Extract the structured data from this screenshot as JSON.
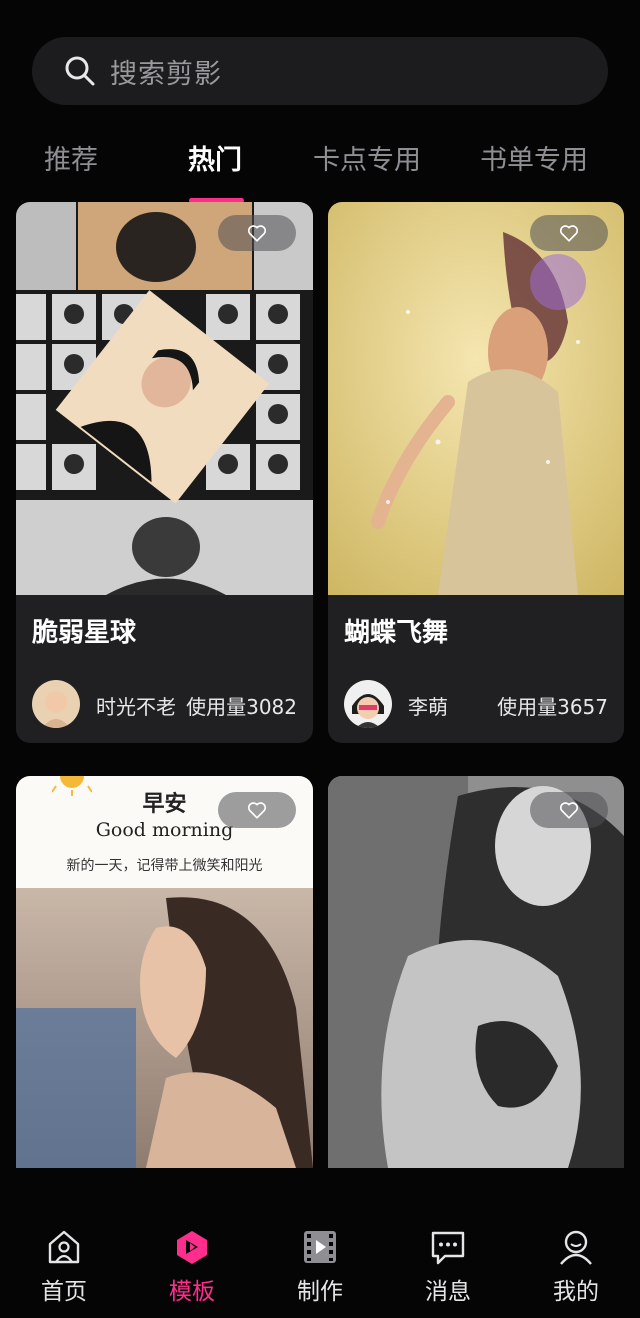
{
  "search": {
    "placeholder": "搜索剪影"
  },
  "tabs": [
    {
      "label": "推荐",
      "active": false
    },
    {
      "label": "热门",
      "active": true
    },
    {
      "label": "卡点专用",
      "active": false
    },
    {
      "label": "书单专用",
      "active": false
    }
  ],
  "cards": [
    {
      "title": "脆弱星球",
      "author": "时光不老",
      "usage": "使用量3082",
      "thumbnail": "collage-bw-portraits-photo"
    },
    {
      "title": "蝴蝶飞舞",
      "author": "李萌",
      "usage": "使用量3657",
      "thumbnail": "dancing-girl-yellow-photo"
    },
    {
      "thumbnail_heading": "早安",
      "thumbnail_subheading": "Good morning",
      "thumbnail_caption": "新的一天，记得带上微笑和阳光",
      "thumbnail": "woman-profile-photo"
    },
    {
      "thumbnail": "bw-woman-portrait-photo"
    }
  ],
  "nav": [
    {
      "label": "首页",
      "icon": "home-person-icon",
      "active": false
    },
    {
      "label": "模板",
      "icon": "template-icon",
      "active": true
    },
    {
      "label": "制作",
      "icon": "film-play-icon",
      "active": false
    },
    {
      "label": "消息",
      "icon": "message-icon",
      "active": false
    },
    {
      "label": "我的",
      "icon": "profile-icon",
      "active": false
    }
  ],
  "colors": {
    "accent": "#ff2e8c",
    "background": "#050506",
    "card": "#202022"
  }
}
